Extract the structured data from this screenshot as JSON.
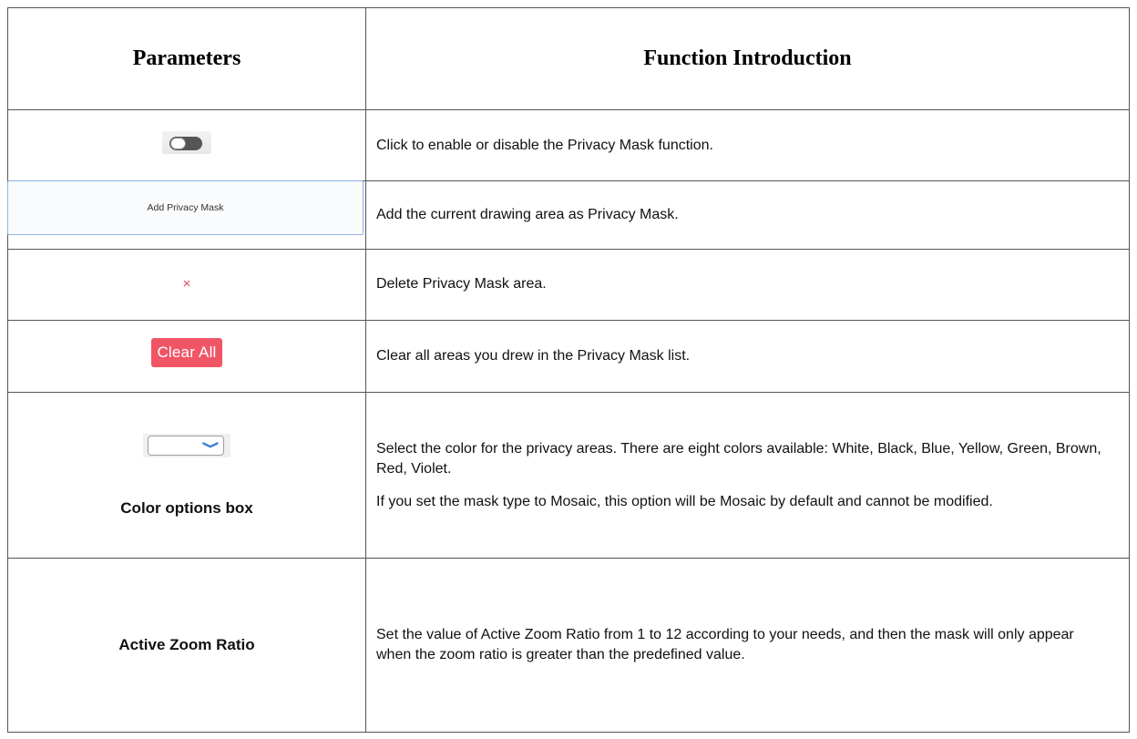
{
  "header": {
    "parameters": "Parameters",
    "function_introduction": "Function Introduction"
  },
  "rows": [
    {
      "param_widget": "toggle-switch",
      "description": "Click to enable or disable the Privacy Mask function."
    },
    {
      "param_widget": "button",
      "button_label": "Add Privacy Mask",
      "description": "Add the current drawing area as Privacy Mask."
    },
    {
      "param_widget": "delete-icon",
      "icon_glyph": "×",
      "description": "Delete Privacy Mask area."
    },
    {
      "param_widget": "button",
      "button_label": "Clear All",
      "description": "Clear all areas you drew in the Privacy Mask list."
    },
    {
      "param_widget": "select",
      "param_label": "Color options box",
      "description": [
        "Select the color for the privacy areas. There are eight colors available: White, Black, Blue, Yellow, Green, Brown, Red, Violet.",
        "If you set the mask type to Mosaic, this option will be Mosaic by default and cannot be modified."
      ]
    },
    {
      "param_label": "Active Zoom Ratio",
      "description": "Set the value of Active Zoom Ratio from 1 to 12 according to your needs, and then the mask will only appear when the zoom ratio is greater than the predefined value."
    }
  ],
  "colors": {
    "clear_button_bg": "#f05566",
    "delete_icon": "#e0445a",
    "select_chevron": "#3a7fd6",
    "add_button_border": "#8fb3e6",
    "table_border": "#555555"
  },
  "icons": {
    "delete": "close-icon",
    "select_arrow": "chevron-down-icon"
  }
}
